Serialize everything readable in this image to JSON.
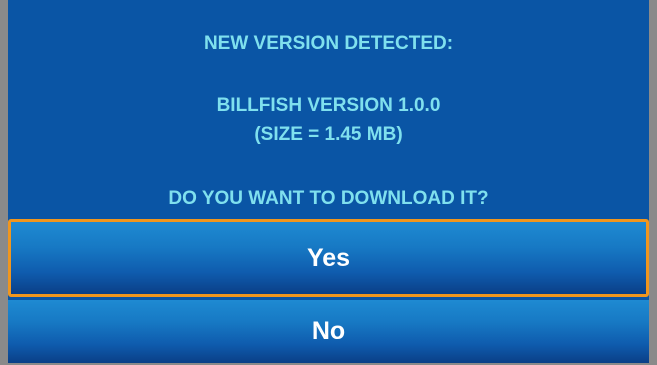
{
  "dialog": {
    "header": "NEW VERSION DETECTED:",
    "product_line": "BILLFISH VERSION 1.0.0",
    "size_line": "(SIZE = 1.45 MB)",
    "question": "DO YOU WANT TO DOWNLOAD IT?"
  },
  "buttons": {
    "yes_label": "Yes",
    "no_label": "No"
  },
  "colors": {
    "dialog_background": "#0a55a5",
    "message_text": "#7fe0ee",
    "button_text": "#ffffff",
    "focus_border": "#f0961e",
    "outer_frame": "#8a8a8a"
  }
}
